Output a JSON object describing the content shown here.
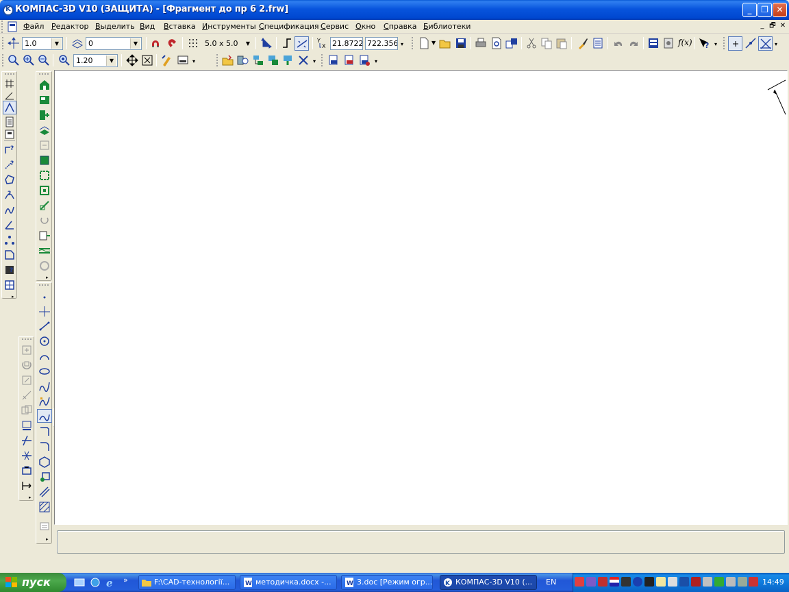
{
  "window": {
    "title": "КОМПАС-3D V10 (ЗАЩИТА) - [Фрагмент до пр 6  2.frw]",
    "buttons": {
      "minimize": "_",
      "restore": "❐",
      "close": "✕"
    }
  },
  "menu": {
    "items": [
      "Файл",
      "Редактор",
      "Выделить",
      "Вид",
      "Вставка",
      "Инструменты",
      "Спецификация",
      "Сервис",
      "Окно",
      "Справка",
      "Библиотеки"
    ],
    "mdi_buttons": [
      "_",
      "🗗",
      "✕"
    ]
  },
  "toolbar1": {
    "step_value": "1.0",
    "layer_value": "0",
    "grid_value": "5.0 x 5.0",
    "coord_x": "21.8722",
    "coord_y": "722.356"
  },
  "toolbar2": {
    "zoom_value": "1.20"
  },
  "taskbar": {
    "start_label": "пуск",
    "tasks": [
      {
        "label": "F:\\CAD-технології..."
      },
      {
        "label": "методичка.docx -..."
      },
      {
        "label": "3.doc [Режим огр..."
      },
      {
        "label": "КОМПАС-3D V10 (..."
      }
    ],
    "language": "EN",
    "clock": "14:49"
  },
  "colors": {
    "titlebar": "#0a5bd6",
    "taskbar": "#245edb",
    "start_button": "#3c8b3c",
    "canvas": "#ffffff",
    "icon_blue": "#1f3fa0",
    "icon_green": "#1a8a3a"
  }
}
